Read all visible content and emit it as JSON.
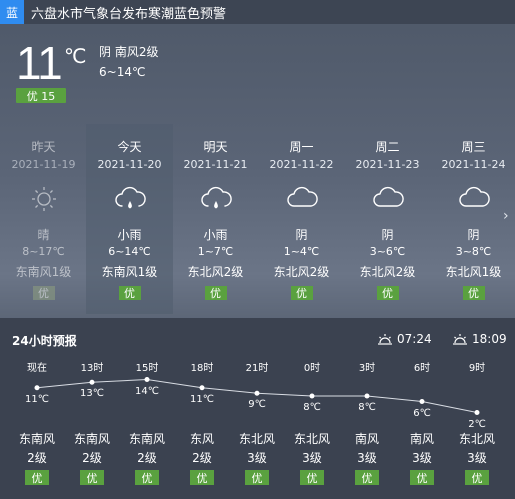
{
  "alert": {
    "badge": "蓝",
    "text": "六盘水市气象台发布寒潮蓝色预警"
  },
  "current": {
    "temp": "11",
    "unit": "℃",
    "condition": "阴   南风2级",
    "range": "6~14℃",
    "aqi": "优 15"
  },
  "days": [
    {
      "name": "昨天",
      "date": "2021-11-19",
      "icon": "sun-icon",
      "cond": "晴",
      "temp": "8~17℃",
      "wind": "东南风1级",
      "aqi": "优"
    },
    {
      "name": "今天",
      "date": "2021-11-20",
      "icon": "rain-icon",
      "cond": "小雨",
      "temp": "6~14℃",
      "wind": "东南风1级",
      "aqi": "优"
    },
    {
      "name": "明天",
      "date": "2021-11-21",
      "icon": "rain-icon",
      "cond": "小雨",
      "temp": "1~7℃",
      "wind": "东北风2级",
      "aqi": "优"
    },
    {
      "name": "周一",
      "date": "2021-11-22",
      "icon": "cloud-icon",
      "cond": "阴",
      "temp": "1~4℃",
      "wind": "东北风2级",
      "aqi": "优"
    },
    {
      "name": "周二",
      "date": "2021-11-23",
      "icon": "cloud-icon",
      "cond": "阴",
      "temp": "3~6℃",
      "wind": "东北风2级",
      "aqi": "优"
    },
    {
      "name": "周三",
      "date": "2021-11-24",
      "icon": "cloud-icon",
      "cond": "阴",
      "temp": "3~8℃",
      "wind": "东北风1级",
      "aqi": "优"
    }
  ],
  "hourly": {
    "title": "24小时预报",
    "sunrise": "07:24",
    "sunset": "18:09",
    "items": [
      {
        "time": "现在",
        "temp": 11,
        "temp_label": "11℃",
        "wind": "东南风",
        "level": "2级",
        "aqi": "优"
      },
      {
        "time": "13时",
        "temp": 13,
        "temp_label": "13℃",
        "wind": "东南风",
        "level": "2级",
        "aqi": "优"
      },
      {
        "time": "15时",
        "temp": 14,
        "temp_label": "14℃",
        "wind": "东南风",
        "level": "2级",
        "aqi": "优"
      },
      {
        "time": "18时",
        "temp": 11,
        "temp_label": "11℃",
        "wind": "东风",
        "level": "2级",
        "aqi": "优"
      },
      {
        "time": "21时",
        "temp": 9,
        "temp_label": "9℃",
        "wind": "东北风",
        "level": "3级",
        "aqi": "优"
      },
      {
        "time": "0时",
        "temp": 8,
        "temp_label": "8℃",
        "wind": "东北风",
        "level": "3级",
        "aqi": "优"
      },
      {
        "time": "3时",
        "temp": 8,
        "temp_label": "8℃",
        "wind": "南风",
        "level": "3级",
        "aqi": "优"
      },
      {
        "time": "6时",
        "temp": 6,
        "temp_label": "6℃",
        "wind": "南风",
        "level": "3级",
        "aqi": "优"
      },
      {
        "time": "9时",
        "temp": 2,
        "temp_label": "2℃",
        "wind": "东北风",
        "level": "3级",
        "aqi": "优"
      }
    ]
  },
  "colors": {
    "good": "#5aa13f",
    "alert_blue": "#2f8cf0"
  }
}
